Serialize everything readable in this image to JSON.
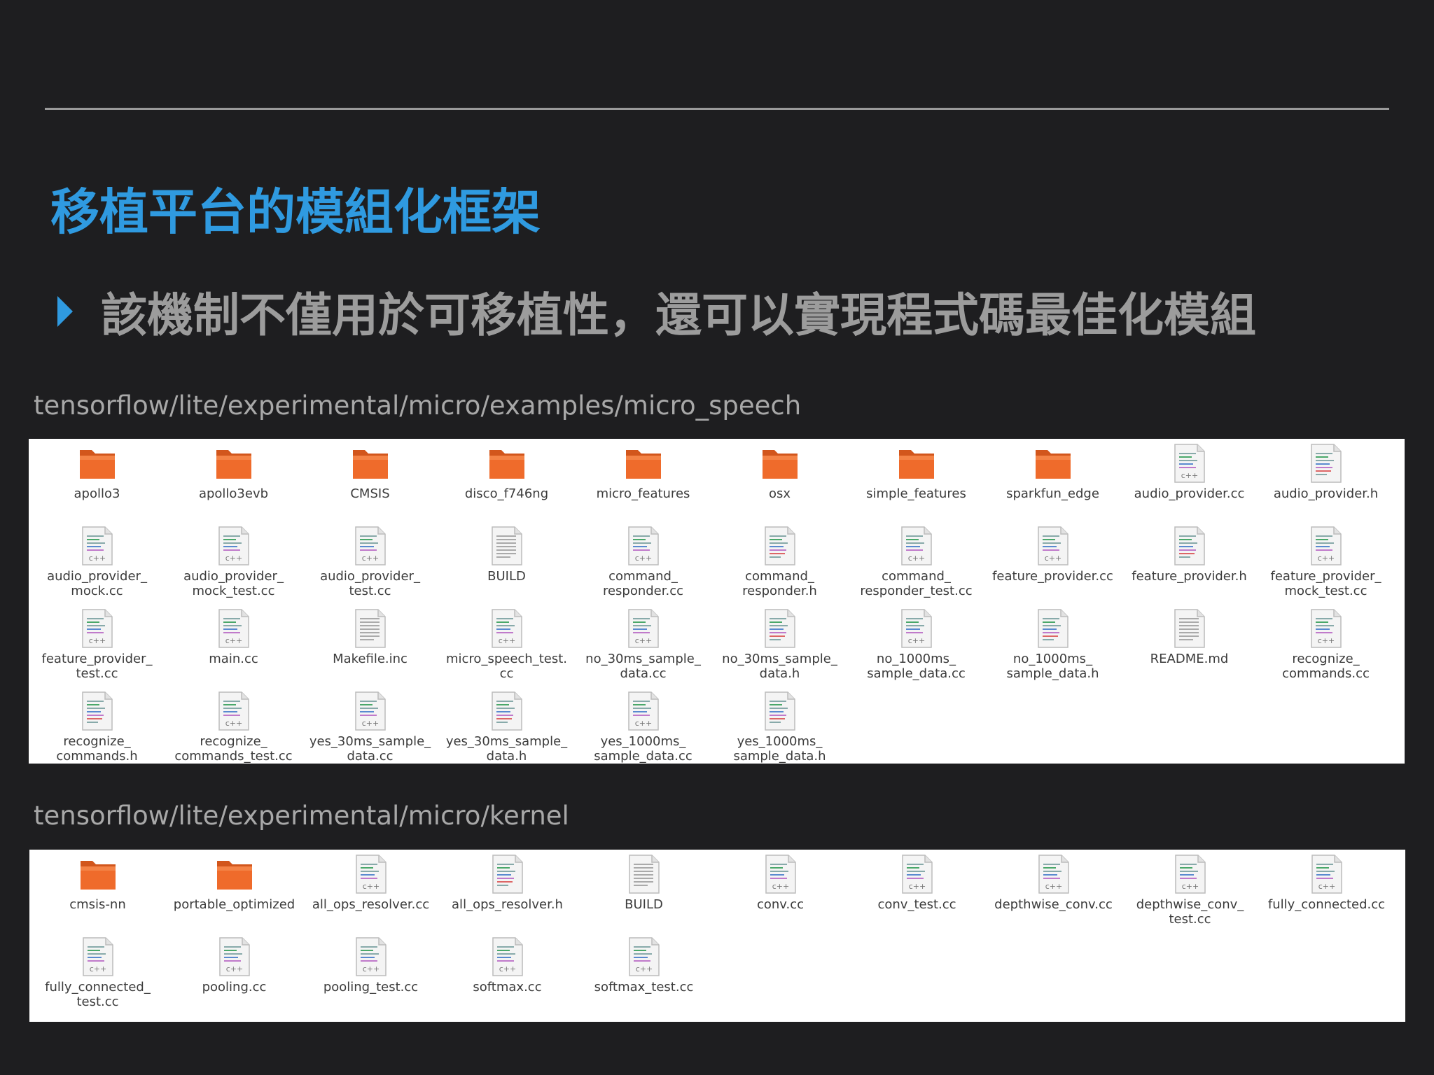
{
  "slide": {
    "title": "移植平台的模組化框架",
    "bullet": "該機制不僅用於可移植性，還可以實現程式碼最佳化模組"
  },
  "panels": [
    {
      "path": "tensorflow/lite/experimental/micro/examples/micro_speech",
      "files": [
        {
          "label": "apollo3",
          "icon": "folder-icon"
        },
        {
          "label": "apollo3evb",
          "icon": "folder-icon"
        },
        {
          "label": "CMSIS",
          "icon": "folder-icon"
        },
        {
          "label": "disco_f746ng",
          "icon": "folder-icon"
        },
        {
          "label": "micro_features",
          "icon": "folder-icon"
        },
        {
          "label": "osx",
          "icon": "folder-icon"
        },
        {
          "label": "simple_features",
          "icon": "folder-icon"
        },
        {
          "label": "sparkfun_edge",
          "icon": "folder-icon"
        },
        {
          "label": "audio_provider.cc",
          "icon": "cpp-file-icon"
        },
        {
          "label": "audio_provider.h",
          "icon": "header-file-icon"
        },
        {
          "label": "audio_provider_\nmock.cc",
          "icon": "cpp-file-icon"
        },
        {
          "label": "audio_provider_\nmock_test.cc",
          "icon": "cpp-file-icon"
        },
        {
          "label": "audio_provider_\ntest.cc",
          "icon": "cpp-file-icon"
        },
        {
          "label": "BUILD",
          "icon": "text-file-icon"
        },
        {
          "label": "command_\nresponder.cc",
          "icon": "cpp-file-icon"
        },
        {
          "label": "command_\nresponder.h",
          "icon": "header-file-icon"
        },
        {
          "label": "command_\nresponder_test.cc",
          "icon": "cpp-file-icon"
        },
        {
          "label": "feature_provider.cc",
          "icon": "cpp-file-icon"
        },
        {
          "label": "feature_provider.h",
          "icon": "header-file-icon"
        },
        {
          "label": "feature_provider_\nmock_test.cc",
          "icon": "cpp-file-icon"
        },
        {
          "label": "feature_provider_\ntest.cc",
          "icon": "cpp-file-icon"
        },
        {
          "label": "main.cc",
          "icon": "cpp-file-icon"
        },
        {
          "label": "Makefile.inc",
          "icon": "text-file-icon"
        },
        {
          "label": "micro_speech_test.\ncc",
          "icon": "cpp-file-icon"
        },
        {
          "label": "no_30ms_sample_\ndata.cc",
          "icon": "cpp-file-icon"
        },
        {
          "label": "no_30ms_sample_\ndata.h",
          "icon": "header-file-icon"
        },
        {
          "label": "no_1000ms_\nsample_data.cc",
          "icon": "cpp-file-icon"
        },
        {
          "label": "no_1000ms_\nsample_data.h",
          "icon": "header-file-icon"
        },
        {
          "label": "README.md",
          "icon": "text-file-icon"
        },
        {
          "label": "recognize_\ncommands.cc",
          "icon": "cpp-file-icon"
        },
        {
          "label": "recognize_\ncommands.h",
          "icon": "header-file-icon"
        },
        {
          "label": "recognize_\ncommands_test.cc",
          "icon": "cpp-file-icon"
        },
        {
          "label": "yes_30ms_sample_\ndata.cc",
          "icon": "cpp-file-icon"
        },
        {
          "label": "yes_30ms_sample_\ndata.h",
          "icon": "header-file-icon"
        },
        {
          "label": "yes_1000ms_\nsample_data.cc",
          "icon": "cpp-file-icon"
        },
        {
          "label": "yes_1000ms_\nsample_data.h",
          "icon": "header-file-icon"
        }
      ]
    },
    {
      "path": "tensorflow/lite/experimental/micro/kernel",
      "files": [
        {
          "label": "cmsis-nn",
          "icon": "folder-icon"
        },
        {
          "label": "portable_optimized",
          "icon": "folder-icon"
        },
        {
          "label": "all_ops_resolver.cc",
          "icon": "cpp-file-icon"
        },
        {
          "label": "all_ops_resolver.h",
          "icon": "header-file-icon"
        },
        {
          "label": "BUILD",
          "icon": "text-file-icon"
        },
        {
          "label": "conv.cc",
          "icon": "cpp-file-icon"
        },
        {
          "label": "conv_test.cc",
          "icon": "cpp-file-icon"
        },
        {
          "label": "depthwise_conv.cc",
          "icon": "cpp-file-icon"
        },
        {
          "label": "depthwise_conv_\ntest.cc",
          "icon": "cpp-file-icon"
        },
        {
          "label": "fully_connected.cc",
          "icon": "cpp-file-icon"
        },
        {
          "label": "fully_connected_\ntest.cc",
          "icon": "cpp-file-icon"
        },
        {
          "label": "pooling.cc",
          "icon": "cpp-file-icon"
        },
        {
          "label": "pooling_test.cc",
          "icon": "cpp-file-icon"
        },
        {
          "label": "softmax.cc",
          "icon": "cpp-file-icon"
        },
        {
          "label": "softmax_test.cc",
          "icon": "cpp-file-icon"
        }
      ]
    }
  ],
  "colors": {
    "title": "#2f9ae0",
    "folder": "#ef6b2b"
  }
}
